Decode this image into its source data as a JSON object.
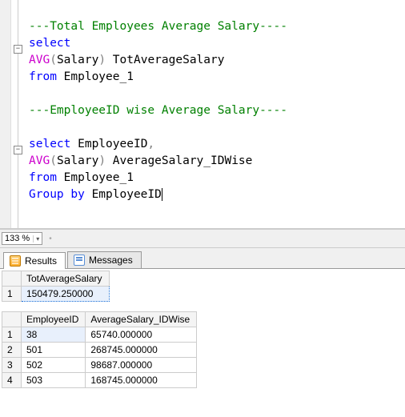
{
  "editor": {
    "lines": [
      {
        "cls": "cm",
        "text": "---Total Employees Average Salary----"
      },
      {
        "parts": [
          {
            "cls": "kw",
            "t": "select"
          }
        ]
      },
      {
        "parts": [
          {
            "cls": "fn",
            "t": "AVG"
          },
          {
            "cls": "op",
            "t": "("
          },
          {
            "cls": "",
            "t": "Salary"
          },
          {
            "cls": "op",
            "t": ")"
          },
          {
            "cls": "",
            "t": " TotAverageSalary"
          }
        ]
      },
      {
        "parts": [
          {
            "cls": "kw",
            "t": "from"
          },
          {
            "cls": "",
            "t": " Employee_1"
          }
        ]
      },
      {
        "cls": "",
        "text": ""
      },
      {
        "cls": "cm",
        "text": "---EmployeeID wise Average Salary----"
      },
      {
        "cls": "",
        "text": ""
      },
      {
        "parts": [
          {
            "cls": "kw",
            "t": "select"
          },
          {
            "cls": "",
            "t": " EmployeeID"
          },
          {
            "cls": "op",
            "t": ","
          }
        ]
      },
      {
        "parts": [
          {
            "cls": "fn",
            "t": "AVG"
          },
          {
            "cls": "op",
            "t": "("
          },
          {
            "cls": "",
            "t": "Salary"
          },
          {
            "cls": "op",
            "t": ")"
          },
          {
            "cls": "",
            "t": " AverageSalary_IDWise"
          }
        ]
      },
      {
        "parts": [
          {
            "cls": "kw",
            "t": "from"
          },
          {
            "cls": "",
            "t": " Employee_1"
          }
        ]
      },
      {
        "parts": [
          {
            "cls": "kw",
            "t": "Group by "
          },
          {
            "cls": "",
            "t": "EmployeeID"
          }
        ]
      }
    ]
  },
  "zoom": {
    "value": "133 %"
  },
  "tabs": {
    "results": "Results",
    "messages": "Messages"
  },
  "grid1": {
    "headers": [
      "TotAverageSalary"
    ],
    "rows": [
      {
        "n": "1",
        "cells": [
          "150479.250000"
        ]
      }
    ]
  },
  "grid2": {
    "headers": [
      "EmployeeID",
      "AverageSalary_IDWise"
    ],
    "rows": [
      {
        "n": "1",
        "cells": [
          "38",
          "65740.000000"
        ]
      },
      {
        "n": "2",
        "cells": [
          "501",
          "268745.000000"
        ]
      },
      {
        "n": "3",
        "cells": [
          "502",
          "98687.000000"
        ]
      },
      {
        "n": "4",
        "cells": [
          "503",
          "168745.000000"
        ]
      }
    ]
  }
}
